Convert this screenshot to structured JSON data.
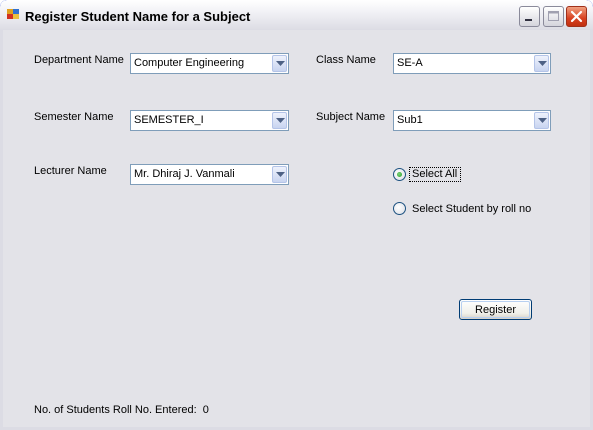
{
  "window": {
    "title": "Register Student Name for a Subject"
  },
  "form": {
    "department": {
      "label": "Department Name",
      "value": "Computer Engineering"
    },
    "class": {
      "label": "Class Name",
      "value": "SE-A"
    },
    "semester": {
      "label": "Semester Name",
      "value": "SEMESTER_I"
    },
    "subject": {
      "label": "Subject Name",
      "value": "Sub1"
    },
    "lecturer": {
      "label": "Lecturer Name",
      "value": "Mr. Dhiraj J. Vanmali"
    },
    "radio_select_all": {
      "label": "Select All",
      "checked": true
    },
    "radio_select_roll": {
      "label": "Select Student by roll no",
      "checked": false
    },
    "register_button": "Register"
  },
  "status": {
    "label": "No. of Students Roll No. Entered:",
    "count": "0"
  },
  "colors": {
    "accent_border": "#7f9db9",
    "client_bg": "#e3e3e8",
    "close_button": "#d84020"
  },
  "icons": [
    "app-icon",
    "minimize-icon",
    "maximize-icon",
    "close-icon",
    "dropdown-arrow-icon"
  ]
}
